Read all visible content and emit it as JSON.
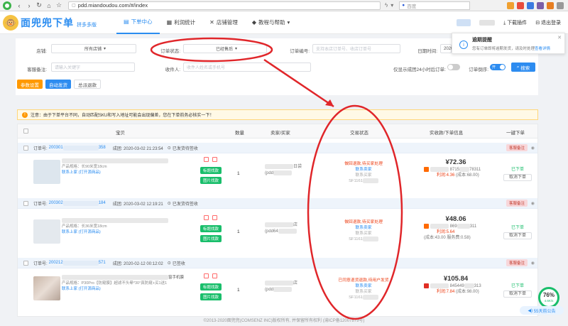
{
  "browser": {
    "url": "pdd.miandoudou.com/#/index",
    "search_placeholder": "百度"
  },
  "header": {
    "brand": "面兜兜下单",
    "brand_sub": "拼多多版",
    "nav": [
      {
        "label": "下单中心",
        "icon": "cart-icon",
        "active": true
      },
      {
        "label": "利润统计",
        "icon": "chart-icon",
        "active": false
      },
      {
        "label": "店铺管理",
        "icon": "tools-icon",
        "active": false
      },
      {
        "label": "教程与帮助",
        "icon": "diamond-icon",
        "active": false
      }
    ],
    "download_plugin": "下载插件",
    "logout": "退出登录"
  },
  "popup": {
    "title": "逾期提醒",
    "text": "您有订单即将逾期发货，请及时处理",
    "link": "查看详情"
  },
  "filters": {
    "shop_label": "店铺:",
    "shop_value": "所有店铺",
    "order_status_label": "订单状态:",
    "order_status_value": "已经售后",
    "order_no_label": "订单编号:",
    "order_no_placeholder": "支持本店订单号、收店订单号",
    "time_label": "日期时间:",
    "time_value": "2020",
    "remark_label": "客服备注:",
    "remark_placeholder": "请输入关键字",
    "receiver_label": "收件人:",
    "receiver_placeholder": "收件人姓名或手机号",
    "only_24h_label": "仅显示成团24小时后订单:",
    "order_sort_label": "订单倒序:",
    "order_sort_toggle": "开",
    "search_button": "搜索",
    "btn_param_settings": "参数设置",
    "btn_auto_ship": "自动发货",
    "btn_batch_refund": "总派退款"
  },
  "notice": "注意：由于下单平台不同，自动匹配SKU和写入地址可能会出现偏差，您在下单前务必核实一下！",
  "table": {
    "headers": [
      "宝贝",
      "数量",
      "卖家/买家",
      "交易状态",
      "实收款/下单信息",
      "一键下单"
    ],
    "orders": [
      {
        "order_no_prefix": "订单号:",
        "order_no_start": "200301",
        "order_no_end": "358",
        "group_time": "成团: 2020-03-02 21:23:54",
        "ship_status": "已发货待签收",
        "remark": "客服备注",
        "spec": "产品规格：长90米宽18cm",
        "contact": "联系上家",
        "open_product": "(打开源商品)",
        "btn_label_ship": "标题找款",
        "btn_image_find": "图片找款",
        "qty": "1",
        "buyer_text": "(pdd",
        "buyer_suffix": "日袋",
        "status_main": "做回退款,待买家处理",
        "status_contact": "联系卖家",
        "status_sub": "联系买家",
        "tracking": "SF1161",
        "amount": "¥72.36",
        "platform_no_pre": "8715",
        "platform_no_end": "78311",
        "profit": "利润:4.36",
        "cost": "(成本:68.00)",
        "op_done": "已下单",
        "op_cancel": "取消下单"
      },
      {
        "order_no_prefix": "订单号:",
        "order_no_start": "200302",
        "order_no_end": "184",
        "group_time": "成团: 2020-03-02 12:19:21",
        "ship_status": "已发货待签收",
        "remark": "客服备注",
        "spec": "产品规格：长36米宽18cm",
        "contact": "联系上家",
        "open_product": "(打开源商品)",
        "btn_label_ship": "标题找款",
        "btn_image_find": "图片找款",
        "qty": "1",
        "buyer_text": "(pdd64",
        "buyer_suffix": "店",
        "status_main": "做回退款,待买家处理",
        "status_contact": "联系卖家",
        "status_sub": "联系买家",
        "tracking": "SF1161",
        "amount": "¥48.06",
        "platform_no_pre": "869",
        "platform_no_end": "311",
        "profit": "利润:5.64",
        "cost": "(成本:43.00",
        "fee": "服务费:0.58)",
        "op_done": "已下单",
        "op_cancel": "取消下单"
      },
      {
        "order_no_prefix": "订单号:",
        "order_no_start": "200212",
        "order_no_end": "571",
        "group_time": "成团: 2020-02-12 00:12:02",
        "ship_status": "已签收",
        "remark": "客服备注",
        "title_suffix": "窗手机膜",
        "spec": "产品规格：P30Pro【防窥膜】超滤不头晕*30°真防窥+买1送1",
        "contact": "联系上家",
        "open_product": "(打开源商品)",
        "btn_label_ship": "标题找款",
        "btn_image_find": "图片找款",
        "qty": "1",
        "buyer_text": "(pdd",
        "buyer_suffix": "店",
        "status_main": "已同意退货退款,待用户发货",
        "status_contact": "联系卖家",
        "status_sub": "联系买家",
        "tracking": "SF1161",
        "amount": "¥105.84",
        "platform_no_pre": "845449",
        "platform_no_end": "313",
        "profit": "利润:7.84",
        "cost": "(成本:98.00)",
        "op_done": "已下单",
        "op_cancel": "取消下单"
      }
    ]
  },
  "footer": "©2013-2020面兜兜(COMSENZ INC)版权所有, 并保留所有权利 (渝ICP备12007879号)",
  "progress": {
    "percent": "76%",
    "speed": "4.6K/s"
  },
  "announce": "55天前公告",
  "colors": {
    "accent": "#2a8cf0",
    "success": "#19be6b",
    "warning": "#ff9900",
    "danger": "#ed3f14",
    "annotation": "#e0262a"
  }
}
